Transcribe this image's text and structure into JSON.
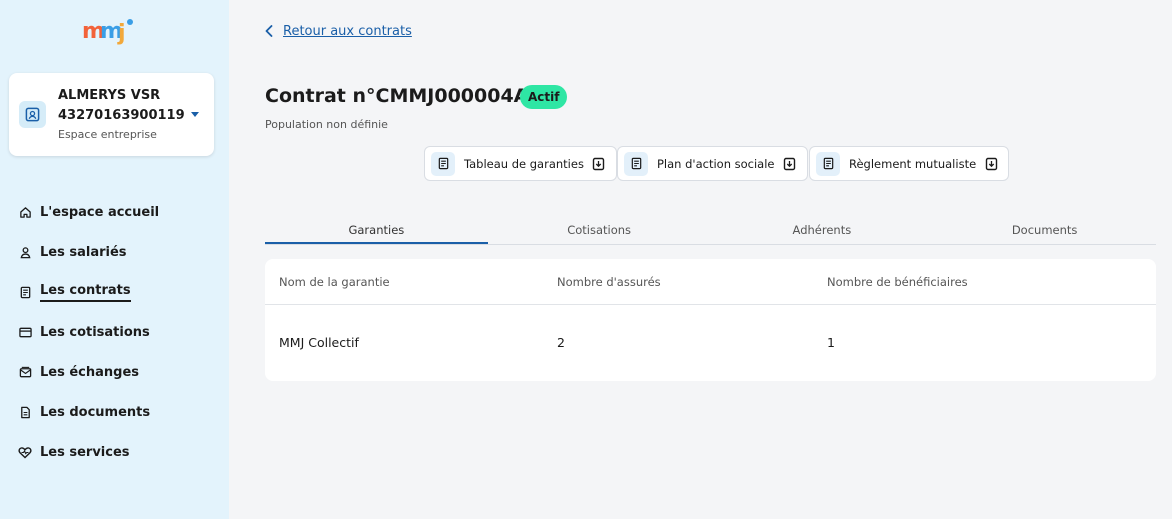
{
  "app": {
    "logo_text": "mmj"
  },
  "colors": {
    "accent": "#1a5fa8",
    "badge": "#2ee6a4",
    "sidebar_bg": "#e3f3fc"
  },
  "account": {
    "name": "ALMERYS VSR",
    "id": "43270163900119",
    "space": "Espace entreprise"
  },
  "sidebar": {
    "items": [
      {
        "label": "L'espace accueil",
        "icon": "home-icon"
      },
      {
        "label": "Les salariés",
        "icon": "user-icon"
      },
      {
        "label": "Les contrats",
        "icon": "contract-icon",
        "active": true
      },
      {
        "label": "Les cotisations",
        "icon": "card-icon"
      },
      {
        "label": "Les échanges",
        "icon": "mail-icon"
      },
      {
        "label": "Les documents",
        "icon": "document-icon"
      },
      {
        "label": "Les services",
        "icon": "heart-icon"
      }
    ]
  },
  "main": {
    "back_label": "Retour aux contrats",
    "title": "Contrat n°CMMJ000004A1",
    "status_badge": "Actif",
    "subtitle": "Population non définie",
    "doc_buttons": [
      {
        "label": "Tableau de garanties"
      },
      {
        "label": "Plan d'action sociale"
      },
      {
        "label": "Règlement mutualiste"
      }
    ],
    "tabs": [
      {
        "label": "Garanties",
        "active": true
      },
      {
        "label": "Cotisations"
      },
      {
        "label": "Adhérents"
      },
      {
        "label": "Documents"
      }
    ],
    "table": {
      "headers": [
        "Nom de la garantie",
        "Nombre d'assurés",
        "Nombre de bénéficiaires"
      ],
      "rows": [
        [
          "MMJ Collectif",
          "2",
          "1"
        ]
      ]
    }
  }
}
